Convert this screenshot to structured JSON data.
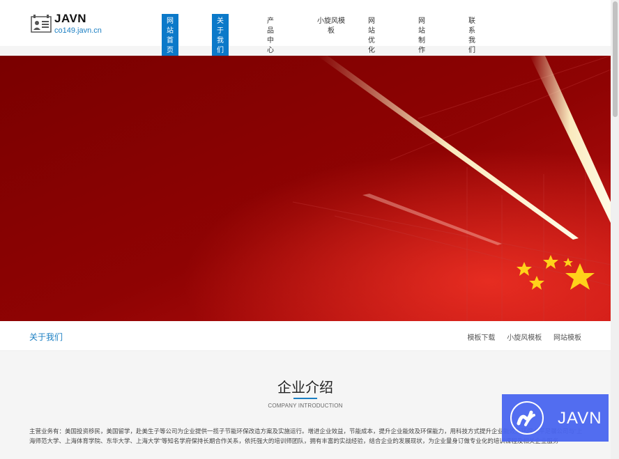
{
  "logo": {
    "name": "JAVN",
    "domain": "co149.javn.cn"
  },
  "nav": {
    "items": [
      {
        "label": "网站首页",
        "active": true
      },
      {
        "label": "关于我们",
        "active": true
      },
      {
        "label": "产品中心",
        "active": false
      },
      {
        "label": "小旋风模板",
        "active": false
      },
      {
        "label": "网站优化",
        "active": false
      },
      {
        "label": "网站制作",
        "active": false
      },
      {
        "label": "联系我们",
        "active": false
      }
    ]
  },
  "banner": {
    "accent": "#8a0000",
    "image": "red-light-streaks-with-chinese-flag"
  },
  "subnav": {
    "title": "关于我们",
    "links": [
      "模板下载",
      "小旋风模板",
      "网站模板"
    ]
  },
  "intro": {
    "title": "企业介绍",
    "subtitle": "COMPANY INTRODUCTION",
    "body": "主营业务有：美国投资移民，美国留学，赴美生子等公司为企业提供一揽子节能环保改造方案及实施运行。增进企业效益，节能成本，提升企业能效及环保能力，用科技方式提升企业能效及环保水平足骥公司与“上海师范大学、上海体育学院、东华大学、上海大学”等知名学府保持长期合作关系，依托强大的培训师团队，拥有丰富的实战经验，结合企业的发展现状，为企业量身订做专业化的培训课程及相关企业服务"
  },
  "badge": {
    "text": "JAVN",
    "color": "#4a66f0"
  }
}
